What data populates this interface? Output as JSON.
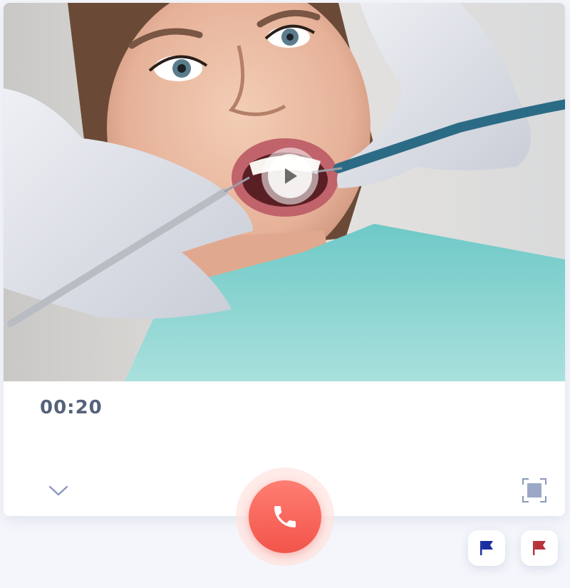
{
  "call": {
    "timer": "00:20"
  },
  "icons": {
    "play": "play-icon",
    "collapse": "chevron-down-icon",
    "fullscreen": "fullscreen-icon",
    "end_call": "phone-icon",
    "flag_blue": "flag-icon",
    "flag_red": "flag-icon"
  },
  "colors": {
    "end_call": "#f2544a",
    "flag_blue": "#1a2fa0",
    "flag_red": "#b8323a",
    "timer_text": "#56627a"
  }
}
